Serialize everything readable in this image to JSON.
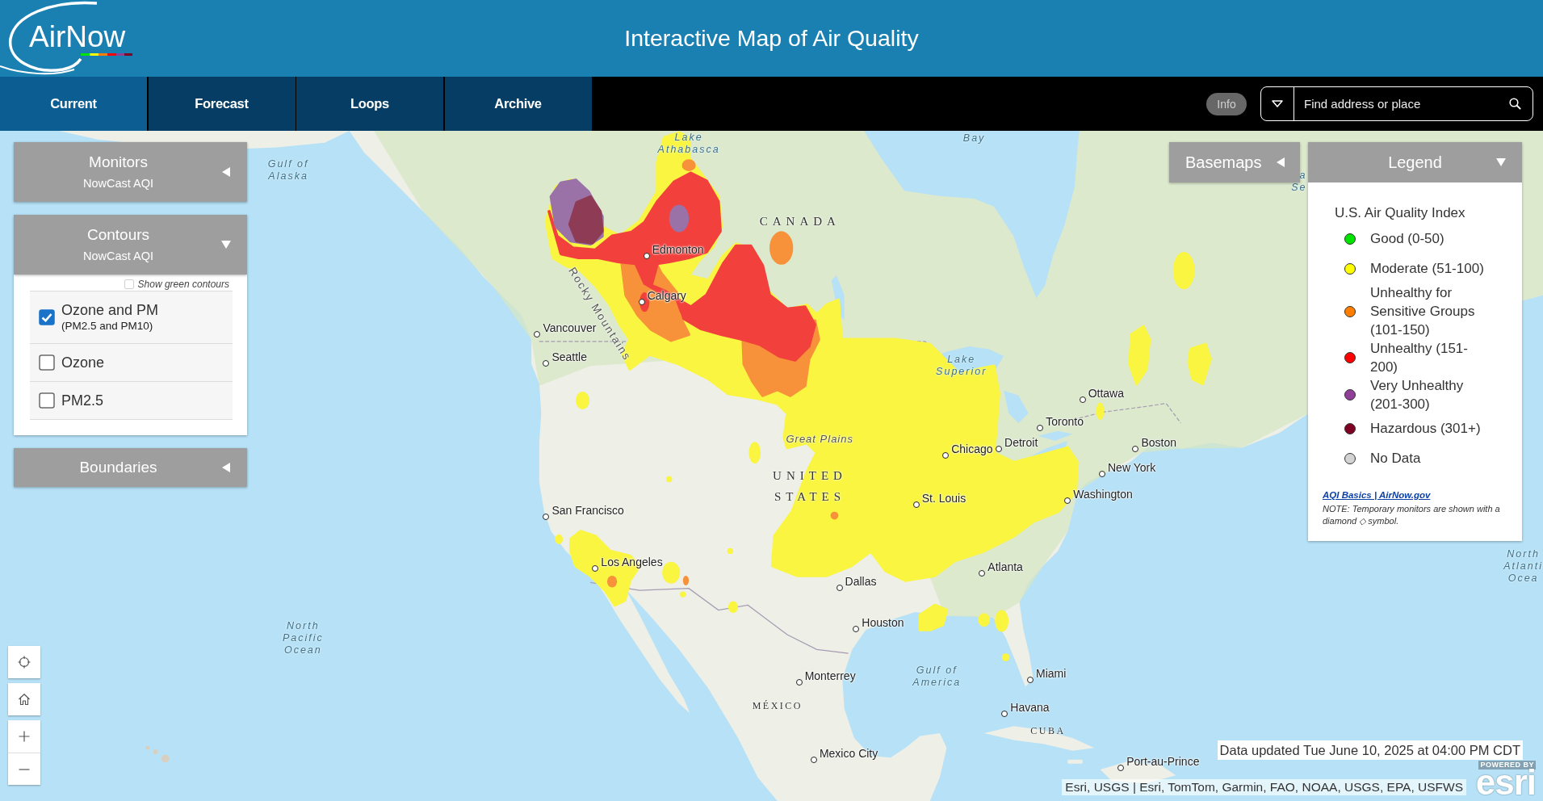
{
  "header": {
    "logo": "AirNow",
    "title": "Interactive Map of Air Quality"
  },
  "tabs": [
    {
      "label": "Current",
      "selected": true
    },
    {
      "label": "Forecast",
      "selected": false
    },
    {
      "label": "Loops",
      "selected": false
    },
    {
      "label": "Archive",
      "selected": false
    }
  ],
  "info_button": "Info",
  "search": {
    "placeholder": "Find address or place"
  },
  "panels": [
    {
      "title": "Monitors",
      "subtitle": "NowCast AQI",
      "expanded": false
    },
    {
      "title": "Contours",
      "subtitle": "NowCast AQI",
      "expanded": true,
      "toggle": {
        "label": "Show green contours",
        "checked": false
      },
      "options": [
        {
          "label": "Ozone and PM",
          "sublabel": "(PM2.5 and PM10)",
          "checked": true
        },
        {
          "label": "Ozone",
          "checked": false
        },
        {
          "label": "PM2.5",
          "checked": false
        }
      ]
    },
    {
      "title": "Boundaries",
      "expanded": false
    }
  ],
  "basemaps": {
    "label": "Basemaps",
    "expanded": false
  },
  "legend": {
    "label": "Legend",
    "expanded": true,
    "title": "U.S. Air Quality Index",
    "items": [
      {
        "label": "Good (0-50)",
        "color": "#00e400"
      },
      {
        "label": "Moderate (51-100)",
        "color": "#ffff00"
      },
      {
        "label": "Unhealthy for Sensitive Groups (101-150)",
        "color": "#ff7e00"
      },
      {
        "label": "Unhealthy (151-200)",
        "color": "#ff0000"
      },
      {
        "label": "Very Unhealthy (201-300)",
        "color": "#8f3f97"
      },
      {
        "label": "Hazardous (301+)",
        "color": "#7e0023"
      },
      {
        "label": "No Data",
        "color": "#d3d3d3"
      }
    ],
    "link": "AQI Basics | AirNow.gov",
    "note": "NOTE: Temporary monitors are shown with a diamond ◇ symbol."
  },
  "map": {
    "labels": [
      {
        "kind": "water",
        "lines": [
          "Lake",
          "Athabasca"
        ]
      },
      {
        "kind": "water",
        "lines": [
          "Bay"
        ]
      },
      {
        "kind": "water",
        "lines": [
          "Gulf of",
          "Alaska"
        ]
      },
      {
        "kind": "water",
        "lines": [
          "a",
          "Se"
        ]
      },
      {
        "kind": "country",
        "lines": [
          "CANADA"
        ]
      },
      {
        "kind": "city",
        "name": "Edmonton"
      },
      {
        "kind": "city",
        "name": "Calgary"
      },
      {
        "kind": "range",
        "lines": [
          "Rocky Mountains"
        ]
      },
      {
        "kind": "city",
        "name": "Vancouver"
      },
      {
        "kind": "city",
        "name": "Seattle"
      },
      {
        "kind": "water",
        "lines": [
          "Lake",
          "Superior"
        ]
      },
      {
        "kind": "city",
        "name": "Ottawa"
      },
      {
        "kind": "city",
        "name": "Toronto"
      },
      {
        "kind": "landform",
        "lines": [
          "Great Plains"
        ]
      },
      {
        "kind": "city",
        "name": "Chicago"
      },
      {
        "kind": "city",
        "name": "Detroit"
      },
      {
        "kind": "city",
        "name": "Boston"
      },
      {
        "kind": "city",
        "name": "New York"
      },
      {
        "kind": "country",
        "lines": [
          "UNITED",
          "STATES"
        ]
      },
      {
        "kind": "city",
        "name": "St. Louis"
      },
      {
        "kind": "city",
        "name": "Washington"
      },
      {
        "kind": "city",
        "name": "San Francisco"
      },
      {
        "kind": "city",
        "name": "Los Angeles"
      },
      {
        "kind": "city",
        "name": "Atlanta"
      },
      {
        "kind": "water",
        "lines": [
          "North",
          "Atlanti",
          "Ocea"
        ]
      },
      {
        "kind": "city",
        "name": "Dallas"
      },
      {
        "kind": "water",
        "lines": [
          "North",
          "Pacific",
          "Ocean"
        ]
      },
      {
        "kind": "city",
        "name": "Houston"
      },
      {
        "kind": "city",
        "name": "Monterrey"
      },
      {
        "kind": "water",
        "lines": [
          "Gulf of",
          "America"
        ]
      },
      {
        "kind": "city",
        "name": "Miami"
      },
      {
        "kind": "countrysmall",
        "lines": [
          "MÉXICO"
        ]
      },
      {
        "kind": "city",
        "name": "Havana"
      },
      {
        "kind": "countrysmall",
        "lines": [
          "CUBA"
        ]
      },
      {
        "kind": "city",
        "name": "Mexico City"
      },
      {
        "kind": "city",
        "name": "Port-au-Prince"
      }
    ]
  },
  "data_updated": "Data updated Tue June 10, 2025 at 04:00 PM CDT",
  "attribution": "Esri, USGS | Esri, TomTom, Garmin, FAO, NOAA, USGS, EPA, USFWS",
  "esri_badge": {
    "caption": "POWERED BY",
    "brand": "esri"
  }
}
